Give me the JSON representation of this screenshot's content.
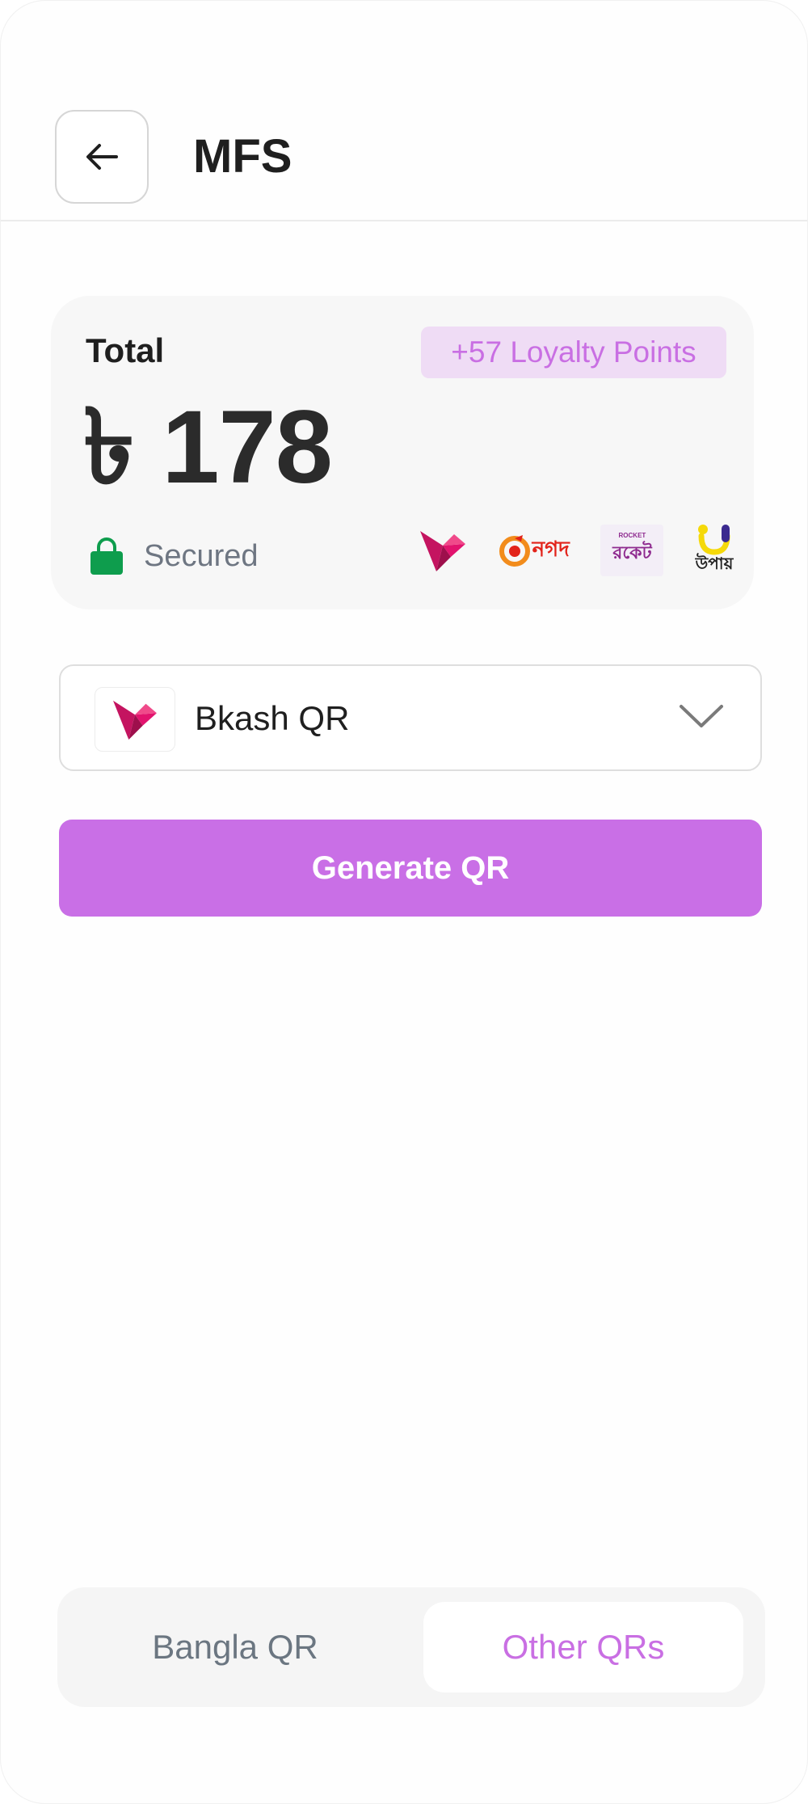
{
  "header": {
    "title": "MFS",
    "back_icon": "arrow-left-icon"
  },
  "summary": {
    "total_label": "Total",
    "amount": "৳ 178",
    "loyalty_badge": "+57 Loyalty Points",
    "secured_label": "Secured",
    "secured_icon": "lock-icon",
    "providers": [
      "bkash-logo",
      "nagad-logo",
      "rocket-logo",
      "upay-logo"
    ],
    "nagad_text": "নগদ",
    "rocket_text": "রকেট",
    "rocket_small": "ROCKET",
    "upay_text": "উপায়"
  },
  "method_select": {
    "selected_label": "Bkash QR",
    "icon": "bkash-logo",
    "chevron": "chevron-down-icon"
  },
  "generate_button": {
    "label": "Generate QR"
  },
  "tabs": [
    {
      "label": "Bangla QR",
      "active": false
    },
    {
      "label": "Other QRs",
      "active": true
    }
  ],
  "colors": {
    "accent": "#c96fe6",
    "badge_bg": "#efdcf5",
    "secure_green": "#0e9d4d",
    "bkash_pink": "#e2136e"
  }
}
